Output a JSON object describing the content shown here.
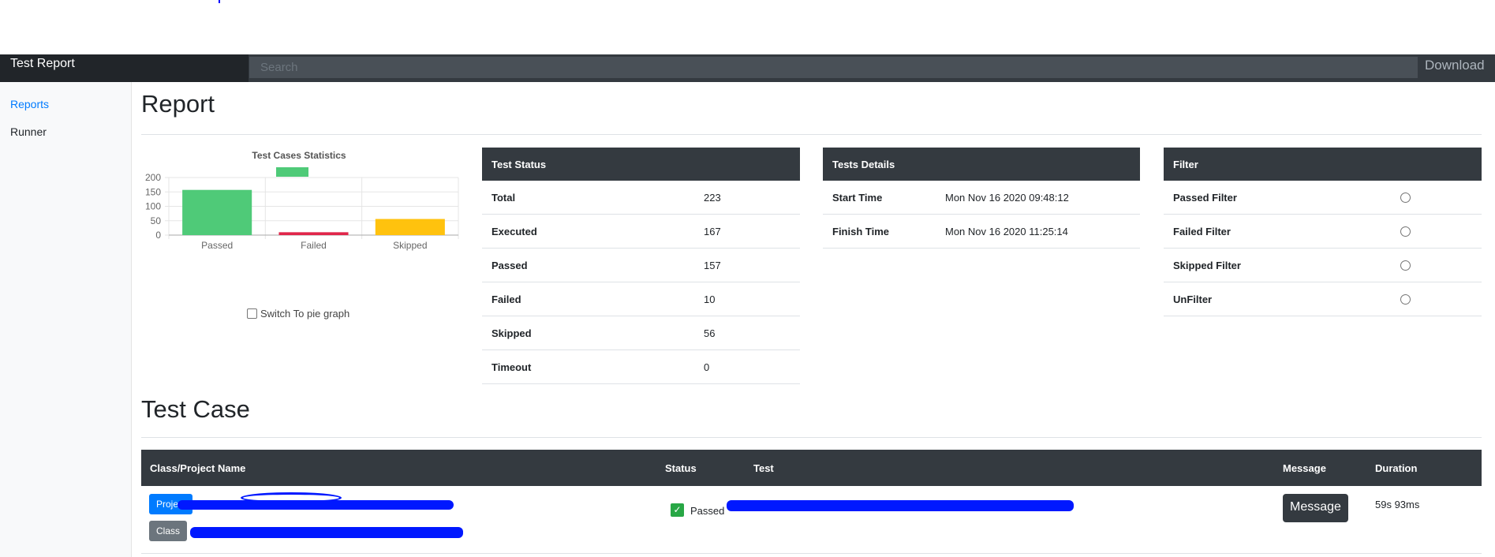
{
  "navbar": {
    "brand": "Test Report",
    "search_placeholder": "Search",
    "download_label": "Download"
  },
  "sidebar": {
    "items": [
      {
        "label": "Reports",
        "active": true
      },
      {
        "label": "Runner",
        "active": false
      }
    ]
  },
  "report": {
    "title": "Report",
    "chart": {
      "title": "Test Cases Statistics",
      "switch_label": "Switch To pie graph"
    },
    "test_status": {
      "header": "Test Status",
      "rows": [
        {
          "label": "Total",
          "value": "223"
        },
        {
          "label": "Executed",
          "value": "167"
        },
        {
          "label": "Passed",
          "value": "157"
        },
        {
          "label": "Failed",
          "value": "10"
        },
        {
          "label": "Skipped",
          "value": "56"
        },
        {
          "label": "Timeout",
          "value": "0"
        }
      ]
    },
    "tests_details": {
      "header": "Tests Details",
      "rows": [
        {
          "label": "Start Time",
          "value": "Mon Nov 16 2020 09:48:12"
        },
        {
          "label": "Finish Time",
          "value": "Mon Nov 16 2020 11:25:14"
        }
      ]
    },
    "filter": {
      "header": "Filter",
      "rows": [
        {
          "label": "Passed Filter"
        },
        {
          "label": "Failed Filter"
        },
        {
          "label": "Skipped Filter"
        },
        {
          "label": "UnFilter"
        }
      ]
    }
  },
  "test_case": {
    "title": "Test Case",
    "columns": [
      "Class/Project Name",
      "Status",
      "Test",
      "Message",
      "Duration"
    ],
    "row": {
      "project_badge": "Project",
      "class_badge": "Class",
      "status": "Passed",
      "message_button": "Message",
      "duration": "59s 93ms"
    }
  },
  "chart_data": {
    "type": "bar",
    "title": "Test Cases Statistics",
    "categories": [
      "Passed",
      "Failed",
      "Skipped"
    ],
    "values": [
      157,
      10,
      56
    ],
    "colors": [
      "#4fca78",
      "#e0264a",
      "#ffc20e"
    ],
    "ylim": [
      0,
      200
    ],
    "yticks": [
      0,
      50,
      100,
      150,
      200
    ],
    "grid": true,
    "legend": "top"
  }
}
